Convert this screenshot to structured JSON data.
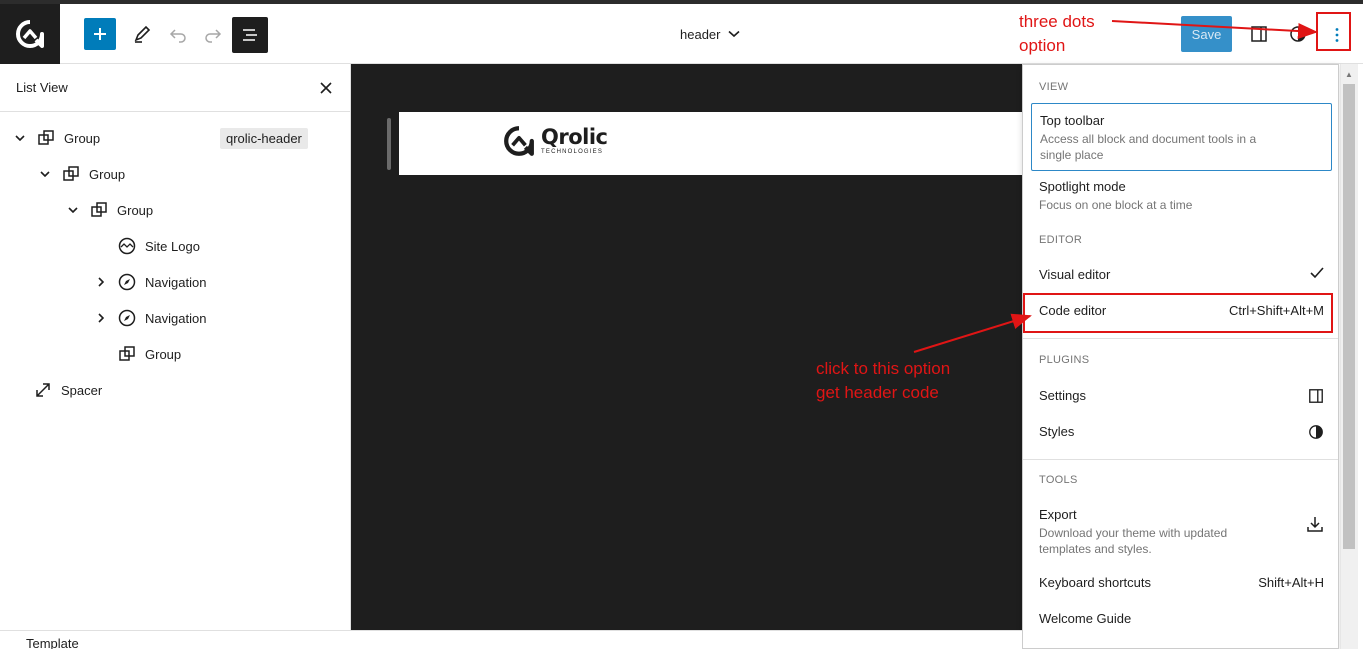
{
  "header": {
    "document_title": "header",
    "save_label": "Save"
  },
  "list_view": {
    "title": "List View",
    "items": [
      {
        "label": "Group",
        "badge": "qrolic-header"
      },
      {
        "label": "Group"
      },
      {
        "label": "Group"
      },
      {
        "label": "Site Logo"
      },
      {
        "label": "Navigation"
      },
      {
        "label": "Navigation"
      },
      {
        "label": "Group"
      },
      {
        "label": "Spacer"
      }
    ]
  },
  "canvas": {
    "logo_main": "Qrolic",
    "logo_sub": "TECHNOLOGIES"
  },
  "options_menu": {
    "view_label": "VIEW",
    "top_toolbar_title": "Top toolbar",
    "top_toolbar_desc": "Access all block and document tools in a single place",
    "spotlight_title": "Spotlight mode",
    "spotlight_desc": "Focus on one block at a time",
    "editor_label": "EDITOR",
    "visual_editor": "Visual editor",
    "code_editor": "Code editor",
    "code_editor_shortcut": "Ctrl+Shift+Alt+M",
    "plugins_label": "PLUGINS",
    "settings": "Settings",
    "styles": "Styles",
    "tools_label": "TOOLS",
    "export_title": "Export",
    "export_desc": "Download your theme with updated templates and styles.",
    "keyboard_shortcuts": "Keyboard shortcuts",
    "keyboard_shortcuts_key": "Shift+Alt+H",
    "welcome_guide": "Welcome Guide"
  },
  "annotations": {
    "three_dots_line1": "three dots",
    "three_dots_line2": "option",
    "click_line1": "click to this option",
    "click_line2": "get header code"
  },
  "footer": {
    "breadcrumb": "Template"
  },
  "colors": {
    "accent": "#007cba",
    "annotation_red": "#e01515",
    "canvas_bg": "#1e1e1e"
  }
}
